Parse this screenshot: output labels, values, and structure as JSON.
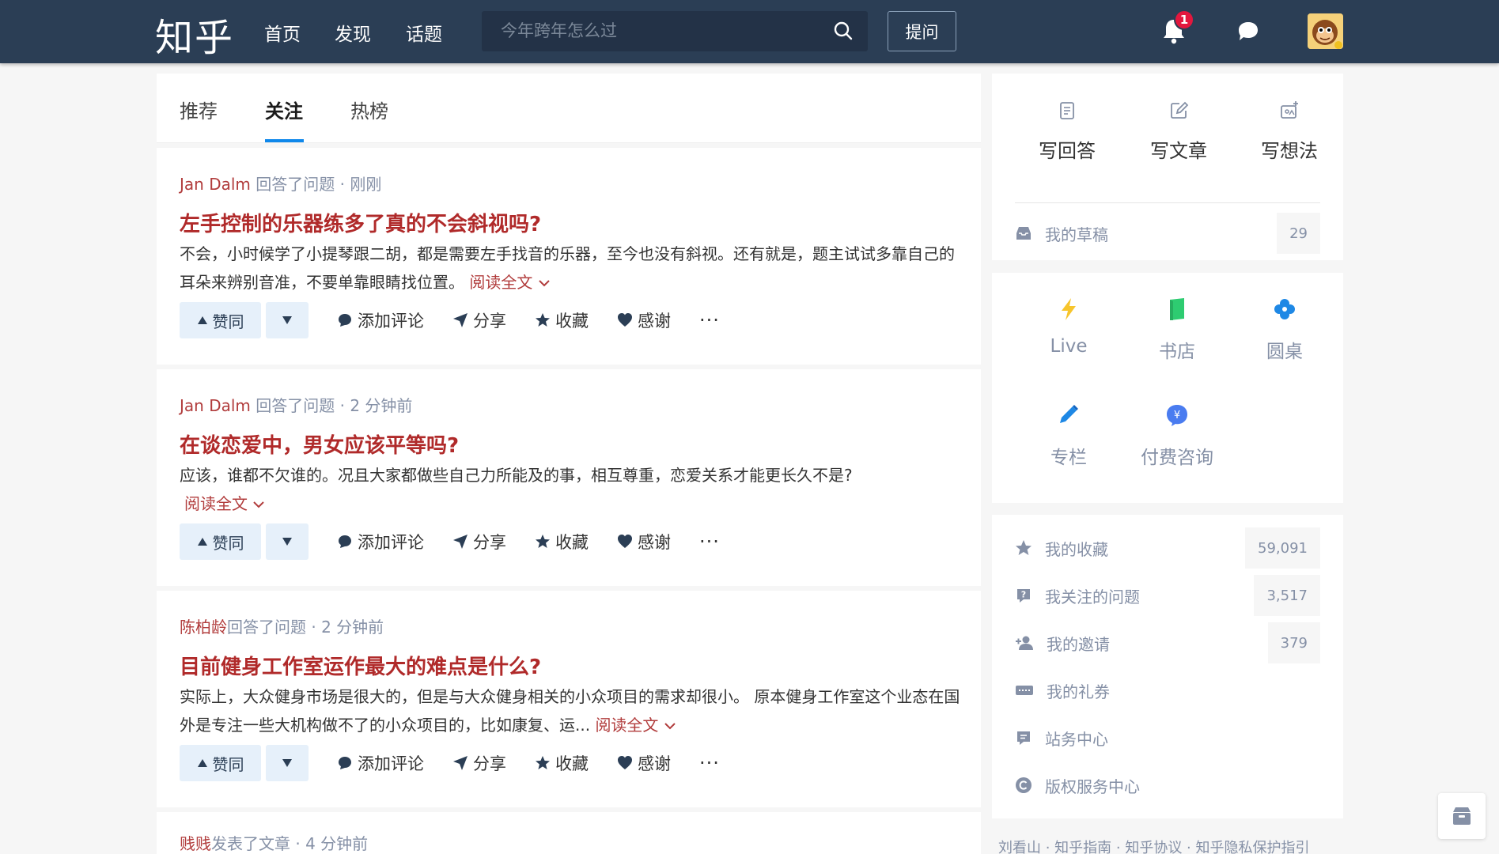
{
  "header": {
    "logo": "知乎",
    "nav": [
      "首页",
      "发现",
      "话题"
    ],
    "search_placeholder": "今年跨年怎么过",
    "ask_label": "提问",
    "notification_count": "1"
  },
  "tabs": [
    "推荐",
    "关注",
    "热榜"
  ],
  "active_tab": "关注",
  "feed": [
    {
      "author": "Jan Dalm",
      "action": " 回答了问题 · 刚刚",
      "title": "左手控制的乐器练多了真的不会斜视吗?",
      "excerpt": "不会，小时候学了小提琴跟二胡，都是需要左手找音的乐器，至今也没有斜视。还有就是，题主试试多靠自己的耳朵来辨别音准，不要单靠眼睛找位置。",
      "read_more": "阅读全文"
    },
    {
      "author": "Jan Dalm",
      "action": " 回答了问题 · 2 分钟前",
      "title": "在谈恋爱中，男女应该平等吗?",
      "excerpt": "应该，谁都不欠谁的。况且大家都做些自己力所能及的事，相互尊重，恋爱关系才能更长久不是?",
      "read_more": "阅读全文"
    },
    {
      "author": "陈柏龄",
      "action": "回答了问题 · 2 分钟前",
      "title": "目前健身工作室运作最大的难点是什么?",
      "excerpt": "实际上，大众健身市场是很大的，但是与大众健身相关的小众项目的需求却很小。 原本健身工作室这个业态在国外是专注一些大机构做不了的小众项目的，比如康复、运...",
      "read_more": "阅读全文"
    },
    {
      "author": "贱贱",
      "action": "发表了文章 · 4 分钟前"
    }
  ],
  "actions": {
    "upvote": "赞同",
    "comment": "添加评论",
    "share": "分享",
    "collect": "收藏",
    "thanks": "感谢",
    "more": "···"
  },
  "side_write": {
    "answer": "写回答",
    "article": "写文章",
    "idea": "写想法",
    "drafts_label": "我的草稿",
    "drafts_count": "29"
  },
  "side_tools": [
    "Live",
    "书店",
    "圆桌",
    "专栏",
    "付费咨询"
  ],
  "side_links": [
    {
      "label": "我的收藏",
      "count": "59,091"
    },
    {
      "label": "我关注的问题",
      "count": "3,517"
    },
    {
      "label": "我的邀请",
      "count": "379"
    },
    {
      "label": "我的礼券",
      "count": ""
    },
    {
      "label": "站务中心",
      "count": ""
    },
    {
      "label": "版权服务中心",
      "count": ""
    }
  ],
  "footer": "刘看山 · 知乎指南 · 知乎协议 · 知乎隐私保护指引",
  "colors": {
    "header": "#2b3e55",
    "accent": "#0f88eb",
    "title_red": "#b02a2a"
  }
}
